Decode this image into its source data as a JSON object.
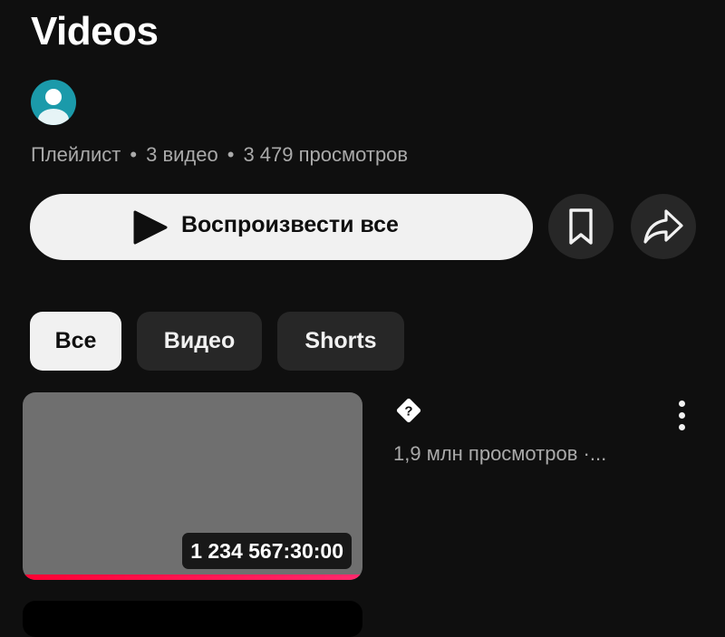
{
  "header": {
    "title": "Videos"
  },
  "playlist": {
    "meta_type": "Плейлист",
    "meta_videos": "3 видео",
    "meta_views": "3 479 просмотров",
    "separator": "•",
    "avatar_icon": "user-avatar-icon",
    "avatar_color": "#1b9aaa"
  },
  "actions": {
    "play_all_label": "Воспроизвести все",
    "play_icon": "play-icon",
    "save_icon": "bookmark-icon",
    "share_icon": "share-arrow-icon"
  },
  "filters": {
    "chips": [
      {
        "label": "Все",
        "active": true
      },
      {
        "label": "Видео",
        "active": false
      },
      {
        "label": "Shorts",
        "active": false
      }
    ]
  },
  "videos": [
    {
      "title_icon": "unknown-question-icon",
      "title_glyph": "?",
      "views": "1,9 млн просмотров ·...",
      "duration": "1 234 567:30:00",
      "watched_fraction": 1.0,
      "progress_color": "#ff0033"
    }
  ]
}
